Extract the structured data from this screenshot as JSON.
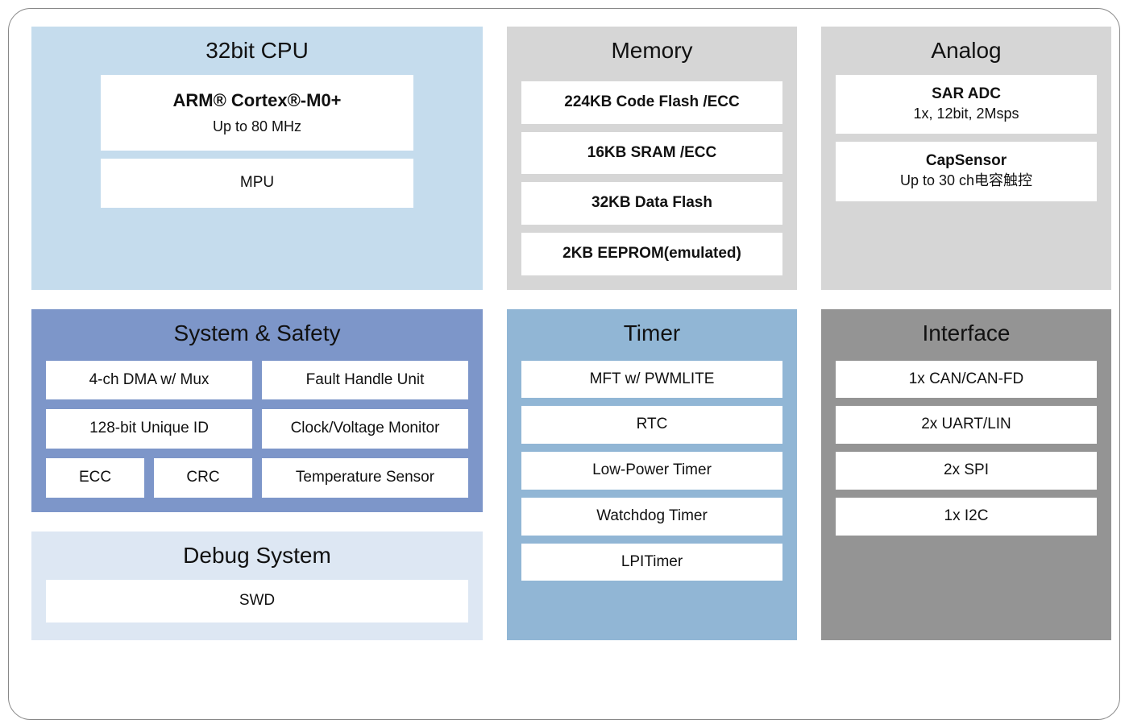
{
  "cpu": {
    "title": "32bit CPU",
    "core_name": "ARM® Cortex®-M0+",
    "speed": "Up to 80 MHz",
    "mpu": "MPU"
  },
  "system": {
    "title": "System & Safety",
    "dma": "4-ch DMA w/ Mux",
    "fault": "Fault Handle Unit",
    "uid": "128-bit Unique ID",
    "cvmon": "Clock/Voltage Monitor",
    "ecc": "ECC",
    "crc": "CRC",
    "temp": "Temperature Sensor"
  },
  "debug": {
    "title": "Debug System",
    "swd": "SWD"
  },
  "memory": {
    "title": "Memory",
    "flash": "224KB Code Flash /ECC",
    "sram": "16KB SRAM /ECC",
    "dflash": "32KB Data Flash",
    "eeprom": "2KB EEPROM(emulated)"
  },
  "timer": {
    "title": "Timer",
    "mft": "MFT w/ PWMLITE",
    "rtc": "RTC",
    "lpt": "Low-Power Timer",
    "wdt": "Watchdog Timer",
    "lpit": "LPITimer"
  },
  "analog": {
    "title": "Analog",
    "adc_name": "SAR ADC",
    "adc_spec": "1x, 12bit, 2Msps",
    "cap_name": "CapSensor",
    "cap_spec": "Up to 30 ch电容触控"
  },
  "interface": {
    "title": "Interface",
    "can": "1x CAN/CAN-FD",
    "uart": "2x UART/LIN",
    "spi": "2x SPI",
    "i2c": "1x I2C"
  }
}
